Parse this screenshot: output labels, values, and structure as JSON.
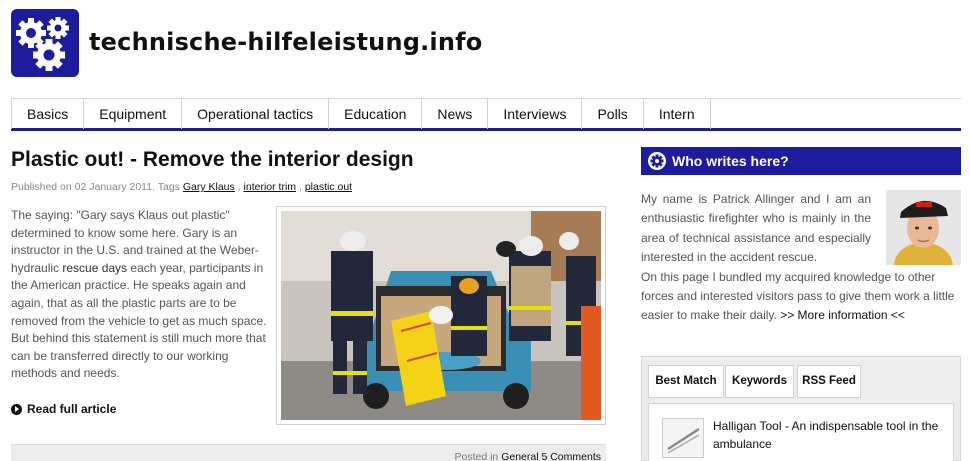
{
  "site": {
    "title": "technische-hilfeleistung.info",
    "logo_icon": "gears-icon",
    "brand_color": "#1c1c9c"
  },
  "nav": {
    "items": [
      "Basics",
      "Equipment",
      "Operational tactics",
      "Education",
      "News",
      "Interviews",
      "Polls",
      "Intern"
    ]
  },
  "article": {
    "title": "Plastic out! - Remove the interior design",
    "published_prefix": "Published on 02 January 2011. Tags ",
    "tags": [
      "Gary Klaus",
      "interior trim",
      "plastic out"
    ],
    "text_before": "The saying: \"Gary says Klaus out plastic\" determined to know some here. Gary is an instructor in the U.S. and trained at the Weber-hydraulic ",
    "highlight": "rescue days",
    "text_after": " each year, participants in the American practice. He speaks again and again, that as all the plastic parts are to be removed from the vehicle to get as much space. But behind this statement is still much more that can be transferred directly to our working methods and needs.",
    "read_more": "Read full article",
    "posted_in_label": "Posted in ",
    "category": "General",
    "comments": "5 Comments"
  },
  "sidebar": {
    "about": {
      "header": "Who writes here?",
      "header_icon": "gear-icon",
      "text_1": "My name is Patrick Allinger and I am an enthusiastic firefighter who is mainly in the area of technical assistance and especially interested in the accident rescue.",
      "text_2": "On this page I bundled my acquired knowledge to other forces and interested visitors pass to give them work a little easier to make their daily.",
      "more_link": ">> More information <<"
    },
    "tabs": [
      "Best Match",
      "Keywords",
      "RSS Feed"
    ],
    "featured_item": "Halligan Tool - An indispensable tool in the ambulance"
  }
}
